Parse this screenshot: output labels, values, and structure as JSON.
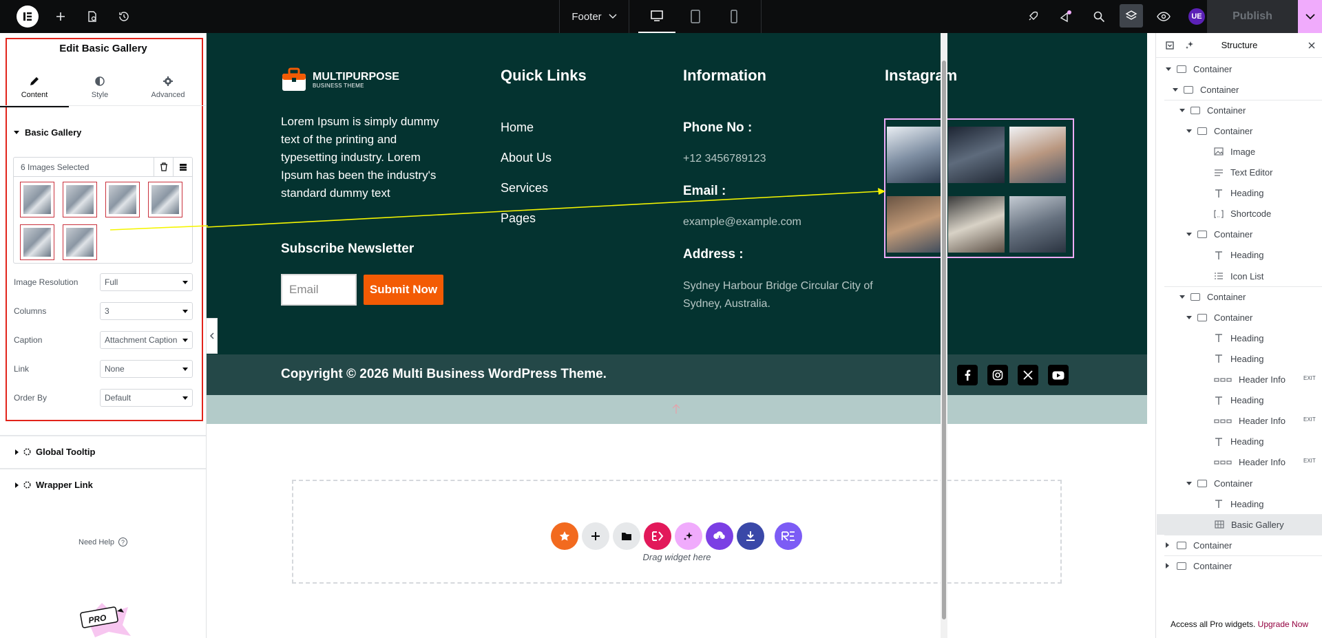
{
  "topbar": {
    "document_name": "Footer",
    "publish_label": "Publish",
    "avatar_initials": "UE"
  },
  "panel": {
    "title": "Edit Basic Gallery",
    "tabs": [
      {
        "label": "Content",
        "icon": "pencil-icon"
      },
      {
        "label": "Style",
        "icon": "contrast-icon"
      },
      {
        "label": "Advanced",
        "icon": "gear-icon"
      }
    ],
    "section_title": "Basic Gallery",
    "gallery_summary": "6 Images Selected",
    "controls": [
      {
        "label": "Image Resolution",
        "value": "Full"
      },
      {
        "label": "Columns",
        "value": "3"
      },
      {
        "label": "Caption",
        "value": "Attachment Caption"
      },
      {
        "label": "Link",
        "value": "None"
      },
      {
        "label": "Order By",
        "value": "Default"
      }
    ],
    "global_tooltip": "Global Tooltip",
    "wrapper_link": "Wrapper Link",
    "need_help": "Need Help",
    "pro_badge": "PRO"
  },
  "footer": {
    "brand_name": "MULTIPURPOSE",
    "brand_sub": "BUSINESS THEME",
    "about_text": "Lorem Ipsum is simply dummy text of the printing and typesetting industry. Lorem Ipsum has been the industry's standard dummy text",
    "quick_links_title": "Quick Links",
    "quick_links": [
      "Home",
      "About Us",
      "Services",
      "Pages"
    ],
    "information_title": "Information",
    "phone_label": "Phone No :",
    "phone_value": "+12 3456789123",
    "email_label": "Email :",
    "email_value": "example@example.com",
    "address_label": "Address :",
    "address_value": "Sydney Harbour Bridge Circular City of Sydney, Australia.",
    "instagram_title": "Instagram",
    "newsletter_title": "Subscribe Newsletter",
    "email_placeholder": "Email",
    "submit_label": "Submit Now",
    "copyright": "Copyright © 2026 Multi Business WordPress Theme.",
    "social_icons": [
      "facebook-icon",
      "instagram-icon",
      "x-icon",
      "youtube-icon"
    ]
  },
  "canvas": {
    "drag_hint": "Drag widget here"
  },
  "structure": {
    "title": "Structure",
    "nodes": [
      {
        "label": "Container",
        "depth": 0,
        "toggle": "open",
        "icon": "container-icon"
      },
      {
        "label": "Container",
        "depth": 1,
        "toggle": "open",
        "icon": "container-icon"
      },
      {
        "label": "Container",
        "depth": 2,
        "toggle": "open",
        "icon": "container-icon"
      },
      {
        "label": "Container",
        "depth": 3,
        "toggle": "open",
        "icon": "container-icon"
      },
      {
        "label": "Image",
        "depth": 4,
        "toggle": "none",
        "icon": "image-icon"
      },
      {
        "label": "Text Editor",
        "depth": 4,
        "toggle": "none",
        "icon": "text-editor-icon"
      },
      {
        "label": "Heading",
        "depth": 4,
        "toggle": "none",
        "icon": "heading-icon"
      },
      {
        "label": "Shortcode",
        "depth": 4,
        "toggle": "none",
        "icon": "shortcode-icon"
      },
      {
        "label": "Container",
        "depth": 3,
        "toggle": "open",
        "icon": "container-icon"
      },
      {
        "label": "Heading",
        "depth": 4,
        "toggle": "none",
        "icon": "heading-icon"
      },
      {
        "label": "Icon List",
        "depth": 4,
        "toggle": "none",
        "icon": "icon-list-icon"
      },
      {
        "label": "Container",
        "depth": 2,
        "toggle": "open",
        "icon": "container-icon"
      },
      {
        "label": "Container",
        "depth": 3,
        "toggle": "open",
        "icon": "container-icon"
      },
      {
        "label": "Heading",
        "depth": 4,
        "toggle": "none",
        "icon": "heading-icon"
      },
      {
        "label": "Heading",
        "depth": 4,
        "toggle": "none",
        "icon": "heading-icon"
      },
      {
        "label": "Header Info",
        "depth": 4,
        "toggle": "none",
        "icon": "header-info-icon",
        "badge": "EXIT"
      },
      {
        "label": "Heading",
        "depth": 4,
        "toggle": "none",
        "icon": "heading-icon"
      },
      {
        "label": "Header Info",
        "depth": 4,
        "toggle": "none",
        "icon": "header-info-icon",
        "badge": "EXIT"
      },
      {
        "label": "Heading",
        "depth": 4,
        "toggle": "none",
        "icon": "heading-icon"
      },
      {
        "label": "Header Info",
        "depth": 4,
        "toggle": "none",
        "icon": "header-info-icon",
        "badge": "EXIT"
      },
      {
        "label": "Container",
        "depth": 3,
        "toggle": "open",
        "icon": "container-icon"
      },
      {
        "label": "Heading",
        "depth": 4,
        "toggle": "none",
        "icon": "heading-icon"
      },
      {
        "label": "Basic Gallery",
        "depth": 4,
        "toggle": "none",
        "icon": "gallery-icon",
        "selected": true
      },
      {
        "label": "Container",
        "depth": 0,
        "toggle": "closed",
        "icon": "container-icon"
      },
      {
        "label": "Container",
        "depth": 0,
        "toggle": "closed",
        "icon": "container-icon"
      }
    ],
    "footer_text": "Access all Pro widgets.",
    "upgrade_label": "Upgrade Now"
  },
  "colors": {
    "footer_bg": "#043330",
    "copyright_bg": "#244848",
    "accent_orange": "#f35b04",
    "selection_red": "#e2231a",
    "highlight_pink": "#f0abfc",
    "annotation_yellow": "#f5f500"
  }
}
